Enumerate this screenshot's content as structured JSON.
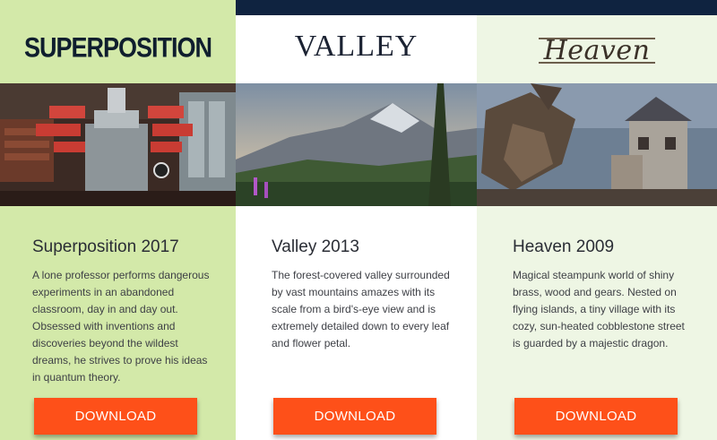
{
  "products": [
    {
      "logo": "SUPERPOSITION",
      "title": "Superposition 2017",
      "description": "A lone professor performs dangerous experiments in an abandoned classroom, day in and day out. Obsessed with inventions and discoveries beyond the wildest dreams, he strives to prove his ideas in quantum theory.",
      "button": "DOWNLOAD",
      "image_icon": "lab-scene-image"
    },
    {
      "logo": "VALLEY",
      "title": "Valley 2013",
      "description": "The forest-covered valley surrounded by vast mountains amazes with its scale from a bird's-eye view and is extremely detailed down to every leaf and flower petal.",
      "button": "DOWNLOAD",
      "image_icon": "mountain-valley-image"
    },
    {
      "logo": "Heaven",
      "title": "Heaven 2009",
      "description": "Magical steampunk world of shiny brass, wood and gears. Nested on flying islands, a tiny village with its cozy, sun-heated cobblestone street is guarded by a majestic dragon.",
      "button": "DOWNLOAD",
      "image_icon": "dragon-village-image"
    }
  ],
  "colors": {
    "accent_button": "#fe5019",
    "col1_bg": "#d3e9a9",
    "col2_bg": "#ffffff",
    "col3_bg": "#eef6e4",
    "top_bar": "#0f2340"
  }
}
